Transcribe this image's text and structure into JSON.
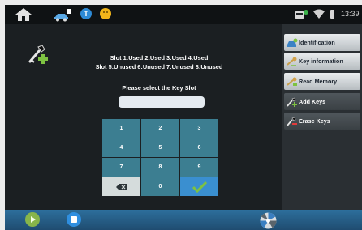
{
  "status_bar": {
    "icons": [
      "home-icon",
      "car-icon",
      "t-app-icon",
      "smiley-icon",
      "vci-icon",
      "wifi-icon",
      "battery-icon"
    ],
    "time": "13:39"
  },
  "main": {
    "slot_line_1": "Slot 1:Used 2:Used 3:Used 4:Used",
    "slot_line_2": "Slot 5:Unused 6:Unused 7:Unused 8:Unused",
    "prompt": "Please select the Key Slot",
    "input_value": "",
    "keypad": [
      "1",
      "2",
      "3",
      "4",
      "5",
      "6",
      "7",
      "8",
      "9",
      "backspace",
      "0",
      "ok"
    ]
  },
  "sidebar": {
    "items": [
      {
        "label": "Identification",
        "icon": "car-id-icon"
      },
      {
        "label": "Key information",
        "icon": "key-info-icon"
      },
      {
        "label": "Read Memory",
        "icon": "read-memory-icon"
      },
      {
        "label": "Add Keys",
        "icon": "add-key-icon"
      },
      {
        "label": "Erase Keys",
        "icon": "erase-key-icon"
      }
    ]
  },
  "bottom_bar": {
    "icons": [
      "play-icon",
      "stop-icon",
      "wheel-icon"
    ]
  },
  "colors": {
    "background": "#1b1f22",
    "keypad_key": "#3c7e91",
    "ok_key": "#3a8fd0",
    "bottom_bar": "#2d6f9c",
    "accent_green": "#7ec242"
  }
}
